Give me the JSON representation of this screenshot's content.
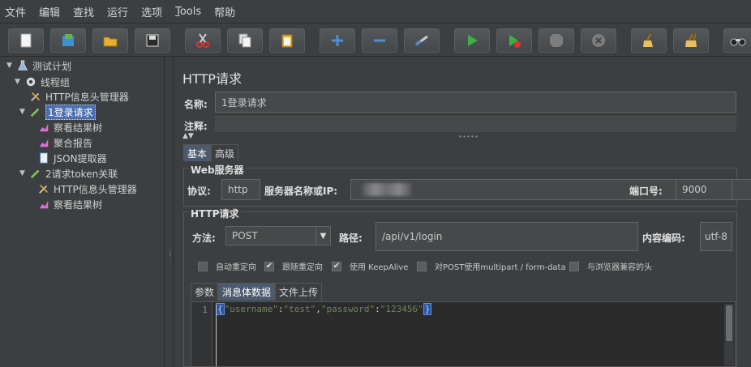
{
  "menubar": {
    "items": [
      {
        "label": "文件"
      },
      {
        "label": "编辑"
      },
      {
        "label": "查找"
      },
      {
        "label": "运行"
      },
      {
        "label": "选项"
      },
      {
        "label_main": "ools",
        "label_ul": "T"
      },
      {
        "label": "帮助"
      }
    ]
  },
  "tree": {
    "test_plan": "测试计划",
    "thread_group": "线程组",
    "header_manager_1": "HTTP信息头管理器",
    "request_1": "1登录请求",
    "view_results_1": "察看结果树",
    "aggregate_report": "聚合报告",
    "json_extractor": "JSON提取器",
    "request_2": "2请求token关联",
    "header_manager_2": "HTTP信息头管理器",
    "view_results_2": "察看结果树"
  },
  "main": {
    "title": "HTTP请求",
    "name_label": "名称:",
    "name_value": "1登录请求",
    "comment_label": "注释:",
    "tabs": [
      {
        "label": "基本"
      },
      {
        "label": "高级"
      }
    ],
    "web_server": {
      "title": "Web服务器",
      "protocol_label": "协议:",
      "protocol_value": "http",
      "server_label": "服务器名称或IP:",
      "port_label": "端口号:",
      "port_value": "9000"
    },
    "http_request": {
      "title": "HTTP请求",
      "method_label": "方法:",
      "method_value": "POST",
      "path_label": "路径:",
      "path_value": "/api/v1/login",
      "encoding_label": "内容编码:",
      "encoding_value": "utf-8"
    },
    "options": [
      {
        "label": "自动重定向",
        "checked": false
      },
      {
        "label": "跟随重定向",
        "checked": true
      },
      {
        "label": "使用 KeepAlive",
        "checked": true
      },
      {
        "label": "对POST使用multipart / form-data",
        "checked": false
      },
      {
        "label": "与浏览器兼容的头",
        "checked": false
      }
    ],
    "body_tabs": [
      {
        "label": "参数"
      },
      {
        "label": "消息体数据"
      },
      {
        "label": "文件上传"
      }
    ],
    "editor": {
      "line_number": "1",
      "open_brace": "{",
      "q": "\"",
      "key1": "username",
      "colon": ":",
      "val1": "test",
      "comma": ",",
      "key2": "password",
      "val2": "123456",
      "close_brace": "}"
    }
  }
}
